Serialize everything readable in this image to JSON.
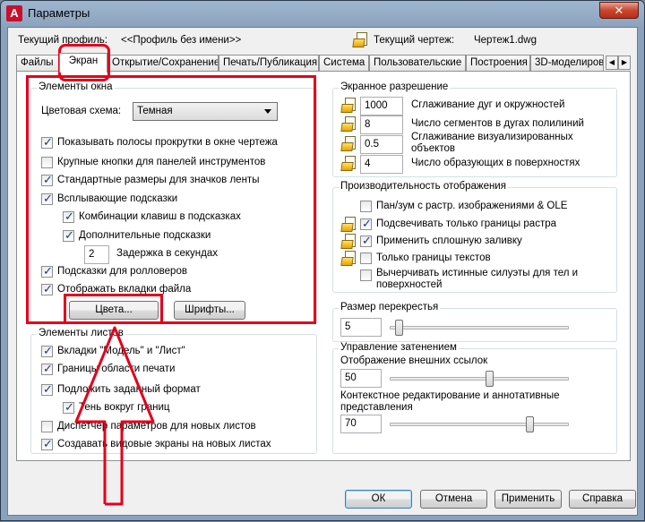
{
  "window": {
    "title": "Параметры",
    "close_label": "✕",
    "app_icon_label": "A"
  },
  "header": {
    "profile_label": "Текущий профиль:",
    "profile_value": "<<Профиль без имени>>",
    "drawing_label": "Текущий чертеж:",
    "drawing_value": "Чертеж1.dwg"
  },
  "tabs": [
    {
      "label": "Файлы"
    },
    {
      "label": "Экран"
    },
    {
      "label": "Открытие/Сохранение"
    },
    {
      "label": "Печать/Публикация"
    },
    {
      "label": "Система"
    },
    {
      "label": "Пользовательские"
    },
    {
      "label": "Построения"
    },
    {
      "label": "3D-моделирова"
    }
  ],
  "tab_scroll": {
    "left": "◀",
    "right": "▶"
  },
  "window_elements": {
    "title": "Элементы окна",
    "color_scheme_label": "Цветовая схема:",
    "color_scheme_value": "Темная",
    "items": [
      {
        "label": "Показывать полосы прокрутки в окне чертежа",
        "checked": true
      },
      {
        "label": "Крупные кнопки для панелей инструментов",
        "checked": false
      },
      {
        "label": "Стандартные размеры для значков ленты",
        "checked": true
      },
      {
        "label": "Всплывающие подсказки",
        "checked": true
      },
      {
        "label": "Комбинации клавиш в подсказках",
        "checked": true
      },
      {
        "label": "Дополнительные подсказки",
        "checked": true
      },
      {
        "label": "Подсказки для ролловеров",
        "checked": true
      },
      {
        "label": "Отображать вкладки файла",
        "checked": true
      }
    ],
    "delay_value": "2",
    "delay_label": "Задержка в секундах",
    "colors_button": "Цвета...",
    "fonts_button": "Шрифты..."
  },
  "layout_elements": {
    "title": "Элементы листов",
    "items": [
      {
        "label": "Вкладки \"Модель\" и \"Лист\"",
        "checked": true
      },
      {
        "label": "Границы области печати",
        "checked": true
      },
      {
        "label": "Подложить заданный формат",
        "checked": true
      },
      {
        "label": "Тень вокруг границ",
        "checked": true
      },
      {
        "label": "Диспетчер параметров для новых листов",
        "checked": false
      },
      {
        "label": "Создавать видовые экраны на новых листах",
        "checked": true
      }
    ]
  },
  "display_resolution": {
    "title": "Экранное разрешение",
    "items": [
      {
        "value": "1000",
        "label": "Сглаживание дуг и окружностей"
      },
      {
        "value": "8",
        "label": "Число сегментов в дугах полилиний"
      },
      {
        "value": "0.5",
        "label": "Сглаживание визуализированных объектов"
      },
      {
        "value": "4",
        "label": "Число образующих в поверхностях"
      }
    ]
  },
  "display_performance": {
    "title": "Производительность отображения",
    "items": [
      {
        "label": "Пан/зум с растр. изображениями & OLE",
        "checked": false
      },
      {
        "label": "Подсвечивать только границы растра",
        "checked": true
      },
      {
        "label": "Применить сплошную заливку",
        "checked": true
      },
      {
        "label": "Только границы текстов",
        "checked": false
      },
      {
        "label": "Вычерчивать истинные силуэты для тел и поверхностей",
        "checked": false
      }
    ]
  },
  "crosshair": {
    "title": "Размер перекрестья",
    "value": "5",
    "level": 5
  },
  "fade": {
    "title": "Управление затенением",
    "xref_label": "Отображение внешних ссылок",
    "xref_value": "50",
    "xref_level": 50,
    "inplace_label": "Контекстное редактирование и аннотативные представления",
    "inplace_value": "70",
    "inplace_level": 70
  },
  "footer": {
    "ok": "ОК",
    "cancel": "Отмена",
    "apply": "Применить",
    "help": "Справка"
  },
  "colors": {
    "annotation": "#e3001b"
  }
}
